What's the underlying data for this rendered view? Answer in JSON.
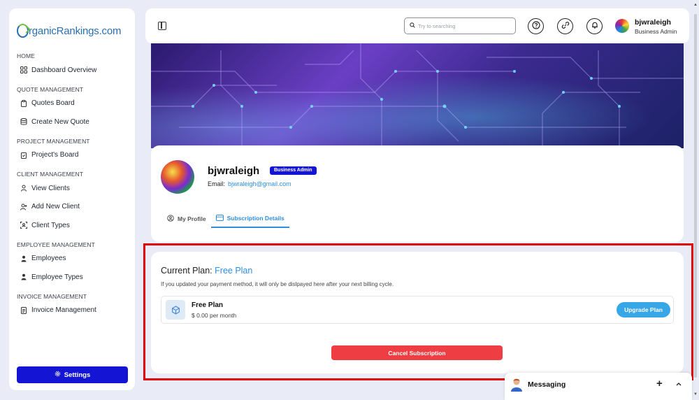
{
  "brand": {
    "logo_text": "rganicRankings.com"
  },
  "sidebar": {
    "sections": [
      {
        "title": "HOME",
        "items": [
          {
            "label": "Dashboard Overview",
            "icon": "grid-icon"
          }
        ]
      },
      {
        "title": "QUOTE MANAGEMENT",
        "items": [
          {
            "label": "Quotes Board",
            "icon": "clipboard-icon"
          },
          {
            "label": "Create New Quote",
            "icon": "database-icon"
          }
        ]
      },
      {
        "title": "PROJECT MANAGEMENT",
        "items": [
          {
            "label": "Project's Board",
            "icon": "clipboard-check-icon"
          }
        ]
      },
      {
        "title": "CLIENT MANAGEMENT",
        "items": [
          {
            "label": "View Clients",
            "icon": "user-icon"
          },
          {
            "label": "Add New Client",
            "icon": "user-plus-icon"
          },
          {
            "label": "Client Types",
            "icon": "user-frame-icon"
          }
        ]
      },
      {
        "title": "EMPLOYEE MANAGEMENT",
        "items": [
          {
            "label": "Employees",
            "icon": "person-icon"
          },
          {
            "label": "Employee Types",
            "icon": "person-icon"
          }
        ]
      },
      {
        "title": "INVOICE MANAGEMENT",
        "items": [
          {
            "label": "Invoice Management",
            "icon": "document-icon"
          }
        ]
      }
    ],
    "settings_label": "Settings"
  },
  "header": {
    "search_placeholder": "Try to searching",
    "user_name": "bjwraleigh",
    "user_role": "Business Admin"
  },
  "profile": {
    "name": "bjwraleigh",
    "badge": "Business Admin",
    "email_label": "Email:",
    "email": "bjwraleigh@gmail.com",
    "tabs": [
      {
        "label": "My Profile",
        "active": false
      },
      {
        "label": "Subscription Details",
        "active": true
      }
    ]
  },
  "subscription": {
    "title_prefix": "Current Plan:",
    "plan_name": "Free Plan",
    "note": "If you updated your payment method, it will only be dislpayed here after your next billing cycle.",
    "row_name": "Free Plan",
    "row_price": "$ 0.00 per month",
    "upgrade_label": "Upgrade Plan",
    "cancel_label": "Cancel Subscription"
  },
  "messaging": {
    "label": "Messaging"
  },
  "colors": {
    "primary": "#1414d4",
    "accent": "#2f8ee0",
    "danger": "#ee3e44",
    "highlight": "#e00000"
  }
}
